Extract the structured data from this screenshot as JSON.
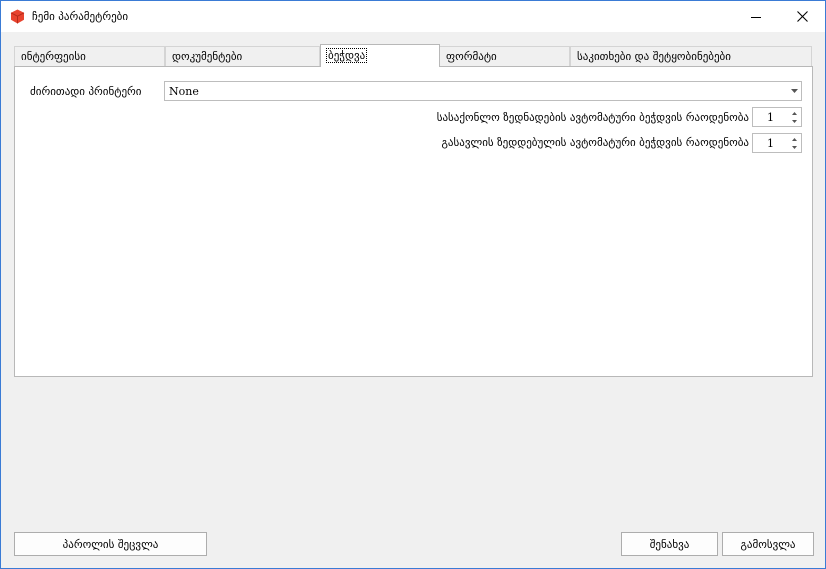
{
  "window": {
    "title": "ჩემი პარამეტრები"
  },
  "icons": {
    "app": "app-logo-icon",
    "minimize": "minimize-icon",
    "close": "close-icon"
  },
  "colors": {
    "app_icon": "#e8432e",
    "window_border": "#3a7bd5"
  },
  "tabs": [
    {
      "label": "ინტერფეისი"
    },
    {
      "label": "დოკუმენტები"
    },
    {
      "label": "ბეჭდვა"
    },
    {
      "label": "ფორმატი"
    },
    {
      "label": "საკითხები და შეტყობინებები"
    }
  ],
  "active_tab": "ბეჭდვა",
  "print": {
    "default_printer_label": "ძირითადი პრინტერი",
    "default_printer_value": "None",
    "goods_copies_label": "სასაქონლო ზედნადების ავტომატური ბეჭდვის რაოდენობა",
    "goods_copies_value": "1",
    "outgoing_copies_label": "გასავლის ზედდებულის ავტომატური ბეჭდვის რაოდენობა",
    "outgoing_copies_value": "1"
  },
  "footer": {
    "change_password": "პაროლის შეცვლა",
    "save": "შენახვა",
    "exit": "გამოსვლა"
  }
}
